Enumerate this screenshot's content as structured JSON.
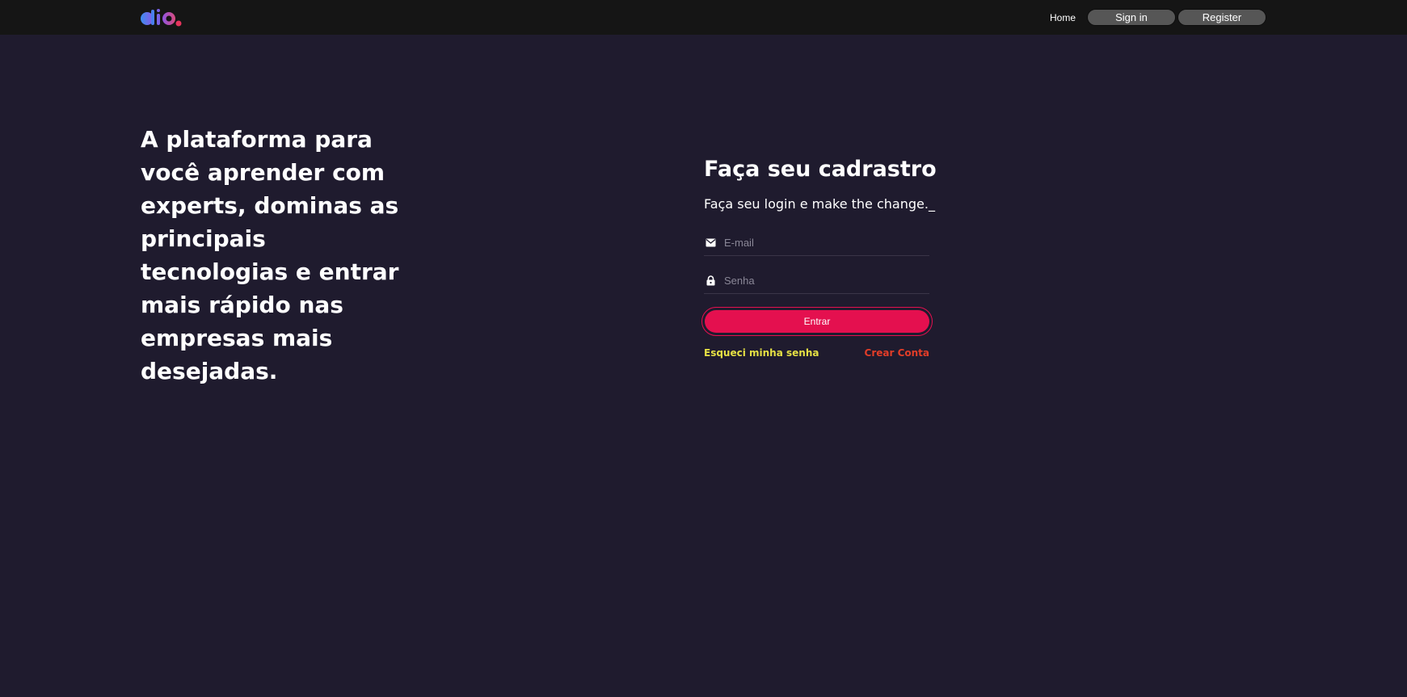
{
  "header": {
    "logo_icon": "dio-logo-icon",
    "nav": {
      "home_label": "Home",
      "signin_label": "Sign in",
      "register_label": "Register"
    }
  },
  "hero": {
    "headline": "A plataforma para você aprender com experts, dominas as principais tecnologias e entrar mais rápido nas empresas mais desejadas."
  },
  "form": {
    "title": "Faça seu cadrastro",
    "subtitle": "Faça seu login e make the change._",
    "email": {
      "icon": "mail-icon",
      "placeholder": "E-mail",
      "value": ""
    },
    "password": {
      "icon": "lock-icon",
      "placeholder": "Senha",
      "value": ""
    },
    "submit_label": "Entrar",
    "forgot_label": "Esqueci minha senha",
    "create_label": "Crear Conta"
  },
  "colors": {
    "background": "#1f1b2e",
    "header": "#151515",
    "accent": "#e4104f",
    "forgot_link": "#e5e044",
    "create_link": "#e23d28"
  }
}
